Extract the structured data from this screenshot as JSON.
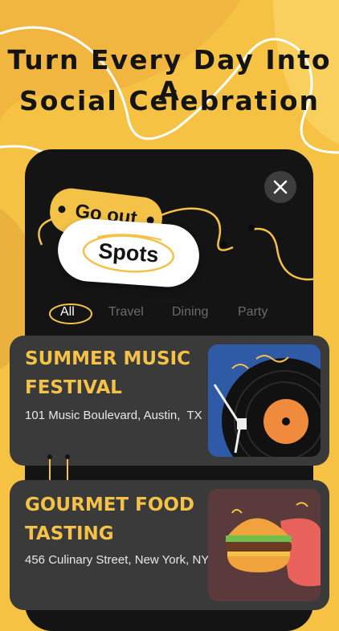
{
  "headline": {
    "line1": "Turn Every Day Into A",
    "line2": "Social Celebration"
  },
  "tags": {
    "go_out": "Go out",
    "spots": "Spots"
  },
  "tabs": [
    {
      "label": "All",
      "active": true
    },
    {
      "label": "Travel",
      "active": false
    },
    {
      "label": "Dining",
      "active": false
    },
    {
      "label": "Party",
      "active": false
    }
  ],
  "events": [
    {
      "title": "SUMMER MUSIC FESTIVAL",
      "title_line1": "SUMMER MUSIC",
      "title_line2": "FESTIVAL",
      "address": "101 Music Boulevard, Austin,  TX",
      "image": "vinyl-record-icon"
    },
    {
      "title": "GOURMET FOOD TASTING",
      "title_line1": "GOURMET FOOD",
      "title_line2": "TASTING",
      "address": "456 Culinary Street, New York, NY",
      "image": "burger-icon"
    }
  ],
  "colors": {
    "background": "#f6c244",
    "accent": "#f3c247",
    "phone": "#141414",
    "card": "#3a3a3a"
  }
}
